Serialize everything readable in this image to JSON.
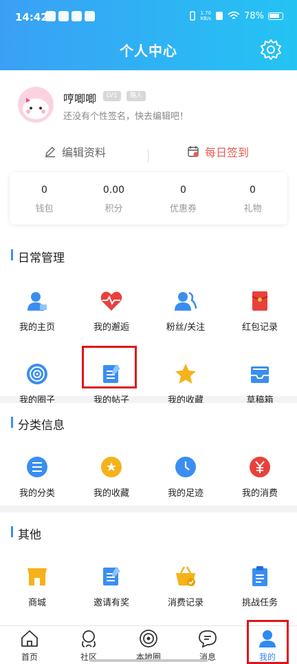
{
  "status_bar": {
    "time": "14:42",
    "speed_top": "1.70",
    "speed_bottom": "KB/s",
    "battery": "78%"
  },
  "header": {
    "title": "个人中心"
  },
  "profile": {
    "username": "哼唧唧",
    "level": "LV1",
    "tag": "路人",
    "signature": "还没有个性签名，快去编辑吧！",
    "edit_label": "编辑资料",
    "checkin_label": "每日签到"
  },
  "stats": [
    {
      "value": "0",
      "label": "钱包"
    },
    {
      "value": "0.00",
      "label": "积分"
    },
    {
      "value": "0",
      "label": "优惠券"
    },
    {
      "value": "0",
      "label": "礼物"
    }
  ],
  "sections": {
    "daily": {
      "title": "日常管理",
      "items": [
        "我的主页",
        "我的邂逅",
        "粉丝/关注",
        "红包记录",
        "我的圈子",
        "我的帖子",
        "我的收藏",
        "草稿箱"
      ]
    },
    "category": {
      "title": "分类信息",
      "items": [
        "我的分类",
        "我的收藏",
        "我的足迹",
        "我的消费"
      ]
    },
    "other": {
      "title": "其他",
      "items": [
        "商城",
        "邀请有奖",
        "消费记录",
        "挑战任务"
      ]
    }
  },
  "tabbar": [
    {
      "label": "首页"
    },
    {
      "label": "社区"
    },
    {
      "label": "本地圈"
    },
    {
      "label": "消息"
    },
    {
      "label": "我的"
    }
  ],
  "colors": {
    "accent": "#3a8ef0",
    "checkin": "#e85b55",
    "highlight": "#e0141c"
  }
}
